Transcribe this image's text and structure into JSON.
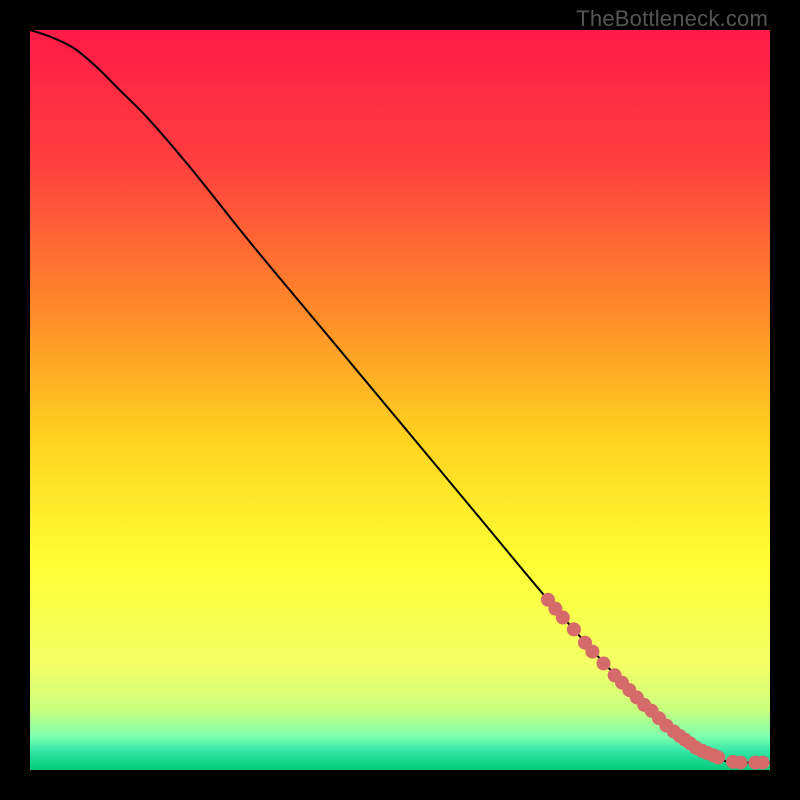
{
  "watermark": "TheBottleneck.com",
  "chart_data": {
    "type": "line",
    "title": "",
    "xlabel": "",
    "ylabel": "",
    "xlim": [
      0,
      100
    ],
    "ylim": [
      0,
      100
    ],
    "background_gradient": {
      "stops": [
        {
          "offset": 0.0,
          "color": "#ff1a47"
        },
        {
          "offset": 0.18,
          "color": "#ff3f3f"
        },
        {
          "offset": 0.38,
          "color": "#ff8a2a"
        },
        {
          "offset": 0.55,
          "color": "#ffd21f"
        },
        {
          "offset": 0.72,
          "color": "#ffff33"
        },
        {
          "offset": 0.86,
          "color": "#f3ff66"
        },
        {
          "offset": 0.92,
          "color": "#c8ff80"
        },
        {
          "offset": 0.955,
          "color": "#7dffb0"
        },
        {
          "offset": 0.975,
          "color": "#33e6a6"
        },
        {
          "offset": 1.0,
          "color": "#00c97a"
        }
      ]
    },
    "series": [
      {
        "name": "bottleneck-curve",
        "color": "#000000",
        "x": [
          0,
          3,
          6,
          9,
          12,
          16,
          22,
          30,
          40,
          50,
          60,
          70,
          78,
          84,
          88,
          91,
          93,
          95,
          97,
          100
        ],
        "y": [
          100,
          99,
          97.5,
          95,
          92,
          88,
          81,
          71,
          59,
          47,
          35,
          23,
          14,
          8,
          4.5,
          2.5,
          1.5,
          1,
          1,
          1
        ]
      }
    ],
    "markers": {
      "name": "highlighted-points",
      "color": "#d46a6a",
      "radius": 7,
      "points": [
        {
          "x": 70,
          "y": 23
        },
        {
          "x": 71,
          "y": 21.8
        },
        {
          "x": 72,
          "y": 20.6
        },
        {
          "x": 73.5,
          "y": 19
        },
        {
          "x": 75,
          "y": 17.2
        },
        {
          "x": 76,
          "y": 16
        },
        {
          "x": 77.5,
          "y": 14.4
        },
        {
          "x": 79,
          "y": 12.8
        },
        {
          "x": 80,
          "y": 11.8
        },
        {
          "x": 81,
          "y": 10.8
        },
        {
          "x": 82,
          "y": 9.8
        },
        {
          "x": 83,
          "y": 8.8
        },
        {
          "x": 84,
          "y": 8
        },
        {
          "x": 85,
          "y": 7
        },
        {
          "x": 86,
          "y": 6
        },
        {
          "x": 87,
          "y": 5.2
        },
        {
          "x": 87.8,
          "y": 4.6
        },
        {
          "x": 88.5,
          "y": 4.1
        },
        {
          "x": 89.2,
          "y": 3.6
        },
        {
          "x": 90,
          "y": 3
        },
        {
          "x": 90.8,
          "y": 2.6
        },
        {
          "x": 91.5,
          "y": 2.3
        },
        {
          "x": 92.3,
          "y": 2
        },
        {
          "x": 93,
          "y": 1.7
        },
        {
          "x": 95,
          "y": 1.1
        },
        {
          "x": 96,
          "y": 1
        },
        {
          "x": 98,
          "y": 1
        },
        {
          "x": 99,
          "y": 1
        }
      ]
    }
  }
}
